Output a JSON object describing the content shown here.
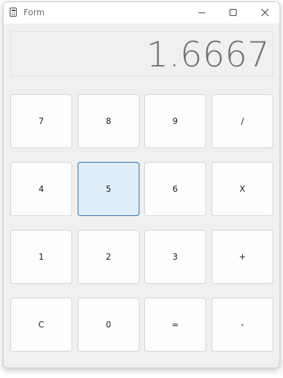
{
  "window": {
    "title": "Form",
    "icon": "calculator-icon"
  },
  "caption_buttons": {
    "minimize_icon": "minimize-icon",
    "maximize_icon": "maximize-icon",
    "close_icon": "close-icon"
  },
  "display": {
    "value": "1.6667"
  },
  "keypad": {
    "rows": [
      [
        "7",
        "8",
        "9",
        "/"
      ],
      [
        "4",
        "5",
        "6",
        "X"
      ],
      [
        "1",
        "2",
        "3",
        "+"
      ],
      [
        "C",
        "0",
        "=",
        "-"
      ]
    ],
    "focused_key": "5"
  },
  "colors": {
    "focused_key_background": "#e0eef9",
    "focused_key_border": "#2b6fa8",
    "display_text": "#707070"
  }
}
